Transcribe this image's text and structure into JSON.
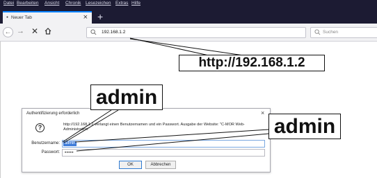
{
  "menubar": {
    "items": [
      "Datei",
      "Bearbeiten",
      "Ansicht",
      "Chronik",
      "Lesezeichen",
      "Extras",
      "Hilfe"
    ]
  },
  "tabs": {
    "active_title": "Neuer Tab",
    "close_glyph": "×",
    "new_tab_glyph": "+"
  },
  "navbar": {
    "url": "192.168.1.2",
    "search_placeholder": "Suchen"
  },
  "dialog": {
    "title": "Authentifizierung erforderlich",
    "close_glyph": "×",
    "icon": "question-icon",
    "message": "http://192.168.1.2 verlangt einen Benutzernamen und ein Passwort. Ausgabe der Website: \"C-MOR Web-Administration\"",
    "username_label": "Benutzername:",
    "username_value": "admin",
    "password_label": "Passwort:",
    "password_mask": "•••••",
    "ok_label": "OK",
    "cancel_label": "Abbrechen"
  },
  "annotations": {
    "url_callout": "http://192.168.1.2",
    "username_callout": "admin",
    "password_callout": "admin"
  },
  "colors": {
    "chrome_dark": "#1c1b33",
    "tab_accent": "#0a84ff",
    "selection": "#3d7bd9"
  }
}
